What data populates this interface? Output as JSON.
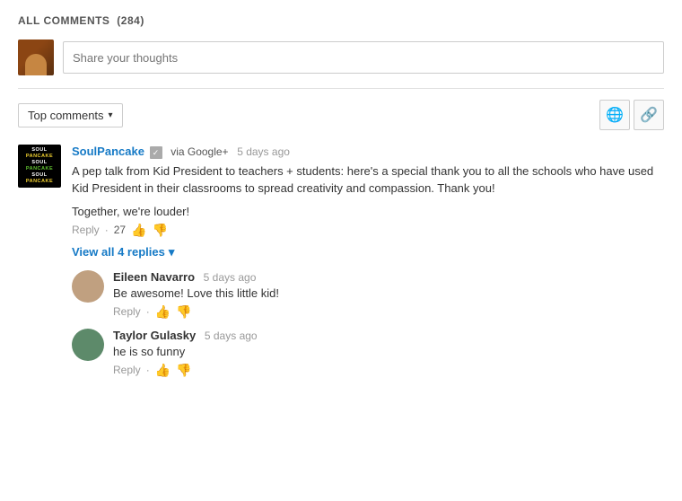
{
  "header": {
    "title": "ALL COMMENTS",
    "count": "(284)"
  },
  "input": {
    "placeholder": "Share your thoughts"
  },
  "sort": {
    "label": "Top comments",
    "chevron": "▾"
  },
  "icons": {
    "globe": "🌐",
    "link": "🔗"
  },
  "comments": [
    {
      "id": "c1",
      "author": "SoulPancake",
      "via": "via Google+",
      "time": "5 days ago",
      "text_main": "A pep talk from Kid President to teachers + students: here's a special thank you to all the schools who have used Kid President in their classrooms to spread creativity and compassion. Thank you!",
      "text_secondary": "Together, we're louder!",
      "reply_label": "Reply",
      "vote_count": "27",
      "replies_label": "View all 4 replies",
      "replies": [
        {
          "id": "r1",
          "author": "Eileen Navarro",
          "time": "5 days ago",
          "text": "Be awesome! Love this little kid!",
          "reply_label": "Reply"
        },
        {
          "id": "r2",
          "author": "Taylor Gulasky",
          "time": "5 days ago",
          "text": "he is so funny",
          "reply_label": "Reply"
        }
      ]
    }
  ]
}
